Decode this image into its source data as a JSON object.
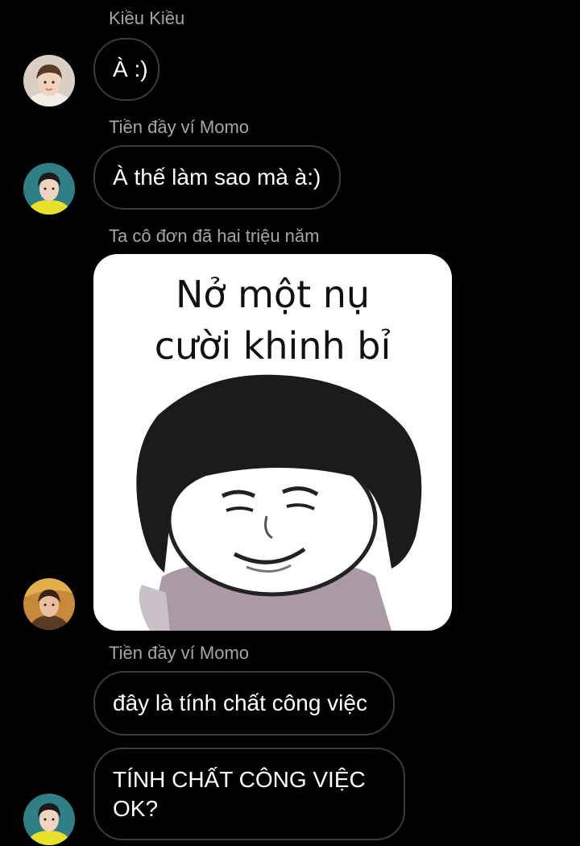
{
  "messages": [
    {
      "sender": "Kiều Kiều",
      "text": "À :)"
    },
    {
      "sender": "Tiền đầy ví Momo",
      "text": "À thế làm sao mà à:)"
    },
    {
      "sender": "Ta cô đơn đã hai triệu năm",
      "sticker_line1": "Nở một nụ",
      "sticker_line2": "cười khinh bỉ"
    },
    {
      "sender": "Tiền đầy ví Momo",
      "text": "đây là tính chất công việc",
      "text2": "TÍNH CHẤT CÔNG VIỆC OK?"
    }
  ],
  "icons": {
    "avatar_kieu": "avatar-photo",
    "avatar_momo": "avatar-photo",
    "avatar_tacodon": "avatar-photo",
    "sticker": "meme-sticker-bowl-cut-face"
  }
}
